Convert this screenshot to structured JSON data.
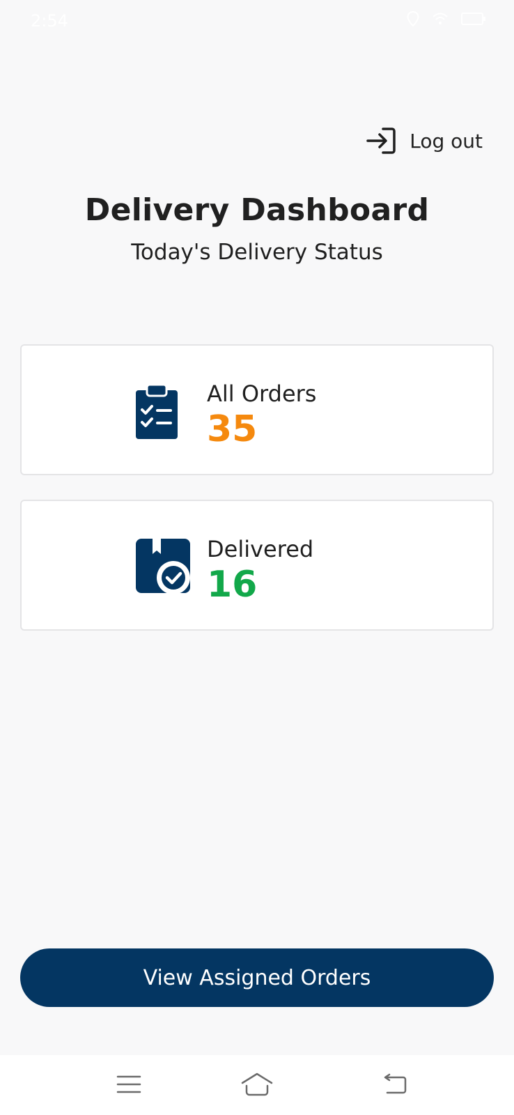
{
  "status_bar": {
    "time": "2:54",
    "icons": [
      "signal-icon",
      "location-icon",
      "wifi-icon",
      "battery-icon"
    ]
  },
  "header": {
    "logout_label": "Log out",
    "logout_icon": "logout-icon"
  },
  "page": {
    "title": "Delivery Dashboard",
    "subtitle": "Today's Delivery Status"
  },
  "cards": [
    {
      "label": "All Orders",
      "value": "35",
      "icon": "clipboard-checklist-icon",
      "value_color": "#f5890e"
    },
    {
      "label": "Delivered",
      "value": "16",
      "icon": "package-delivered-icon",
      "value_color": "#12a84a"
    }
  ],
  "actions": {
    "primary_label": "View Assigned Orders",
    "primary_color": "#043662"
  },
  "navbar": {
    "items": [
      "menu-icon",
      "home-icon",
      "back-icon"
    ]
  }
}
